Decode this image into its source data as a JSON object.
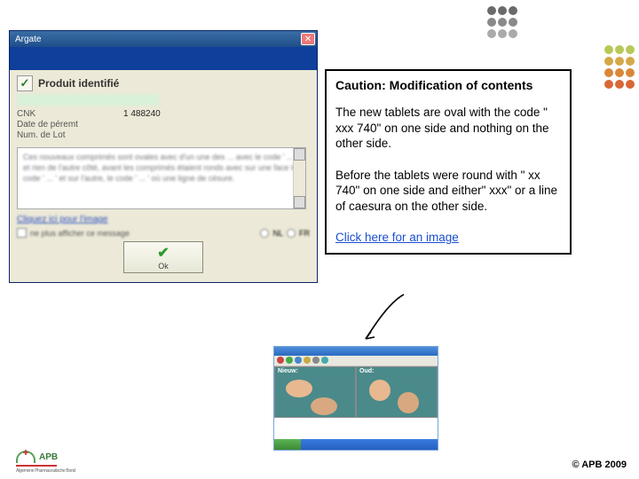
{
  "dots": {
    "left_colors": [
      [
        "#6a6a6a",
        "#6a6a6a",
        "#6a6a6a"
      ],
      [
        "#8a8a8a",
        "#8a8a8a",
        "#8a8a8a"
      ],
      [
        "#aaa",
        "#aaa",
        "#aaa"
      ]
    ],
    "right_colors": [
      [
        "#b8c858",
        "#b8c858",
        "#b8c858"
      ],
      [
        "#d4a848",
        "#d4a848",
        "#d4a848"
      ],
      [
        "#d88838",
        "#d88838",
        "#d88838"
      ],
      [
        "#d86838",
        "#d86838",
        "#d86838"
      ]
    ]
  },
  "dialog": {
    "title": "Argate",
    "product_label": "Produit identifié",
    "cnk_label": "CNK",
    "cnk_value": "1 488240",
    "expiry_label": "Date de péremt",
    "lot_label": "Num. de Lot",
    "body_text": "Ces nouveaux comprimés sont ovales avec d'un une des ... avec le code ' ... ' et rien de l'autre côté, avant les comprimés étaient ronds avec sur une face le code ' ... ' et sur l'autre, le code ' ... ' où une ligne de césure.",
    "image_link": "Cliquez ici pour l'image",
    "no_show": "ne plus afficher ce message",
    "radio_nl": "NL",
    "radio_fr": "FR",
    "ok": "Ok"
  },
  "panel": {
    "title": "Caution: Modification of contents",
    "p1": "The new tablets are oval with the code \" xxx 740\" on one side and nothing on the other side.",
    "p2": "Before the tablets were round with \" xx 740\" on one side and  either\" xxx\" or a line of caesura on the other side.",
    "link": "Click here for an image"
  },
  "thumb": {
    "label_new": "Nieuw:",
    "label_old": "Oud:"
  },
  "logo": {
    "text": "APB",
    "sub": "Algemene Pharmaceutische Bond"
  },
  "copyright": "© APB 2009"
}
